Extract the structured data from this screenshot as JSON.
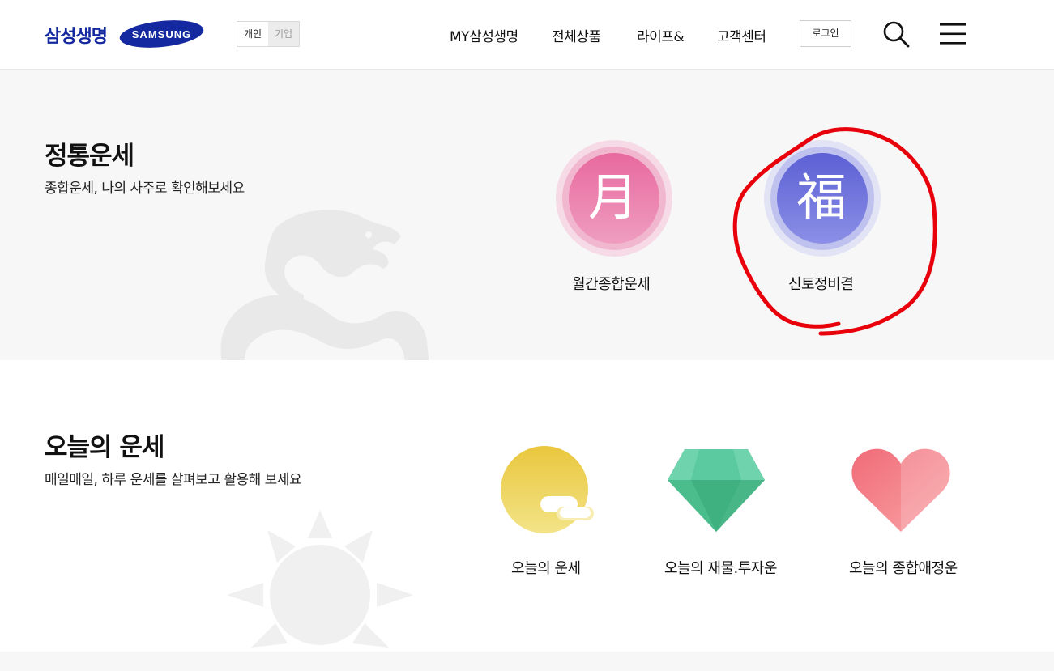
{
  "header": {
    "brand_text": "삼성생명",
    "logo_text": "SAMSUNG",
    "segment": {
      "personal": "개인",
      "corporate": "기업"
    },
    "nav": [
      "MY삼성생명",
      "전체상품",
      "라이프&",
      "고객센터"
    ],
    "login_label": "로그인",
    "icons": [
      "search-icon",
      "hamburger-menu-icon"
    ]
  },
  "section1": {
    "title": "정통운세",
    "subtitle": "종합운세, 나의 사주로 확인해보세요",
    "items": [
      {
        "char": "月",
        "label": "월간종합운세",
        "color": "#e879a8"
      },
      {
        "char": "福",
        "label": "신토정비결",
        "color": "#6a70d8"
      }
    ]
  },
  "section2": {
    "title": "오늘의 운세",
    "subtitle": "매일매일, 하루 운세를 살펴보고 활용해 보세요",
    "items": [
      {
        "label": "오늘의 운세",
        "icon": "moon-cloud-icon"
      },
      {
        "label": "오늘의 재물.투자운",
        "icon": "diamond-icon"
      },
      {
        "label": "오늘의 종합애정운",
        "icon": "heart-icon"
      }
    ]
  },
  "colors": {
    "brand": "#1428a0",
    "annotation": "#e8000b"
  }
}
